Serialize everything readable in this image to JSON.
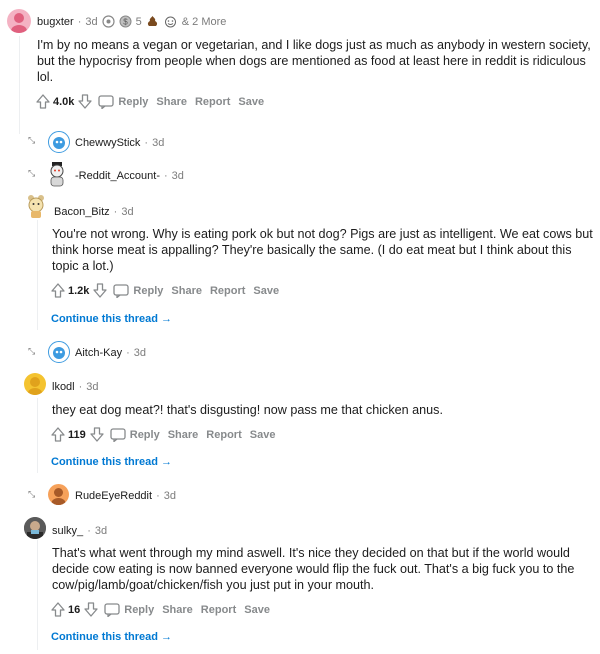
{
  "comments": [
    {
      "username": "bugxter",
      "age": "3d",
      "award_count": "5",
      "more_awards": "& 2 More",
      "text_lines": [
        "I'm by no means a vegan or vegetarian, and I like dogs just as much as anybody in western society,",
        "but the hypocrisy from people when dogs are mentioned as food at least here in reddit is ridiculous",
        "lol."
      ],
      "score": "4.0k"
    },
    {
      "username": "ChewwyStick",
      "age": "3d"
    },
    {
      "username": "-Reddit_Account-",
      "age": "3d"
    },
    {
      "username": "Bacon_Bitz",
      "age": "3d",
      "text_lines": [
        "You're not wrong. Why is eating pork ok but not dog? Pigs are just as intelligent. We eat cows but",
        "think horse meat is appalling? They're basically the same. (I do eat meat but I think about this",
        "topic a lot.)"
      ],
      "score": "1.2k"
    },
    {
      "username": "Aitch-Kay",
      "age": "3d"
    },
    {
      "username": "lkodl",
      "age": "3d",
      "text_lines": [
        "they eat dog meat?! that's disgusting! now pass me that chicken anus."
      ],
      "score": "119"
    },
    {
      "username": "RudeEyeReddit",
      "age": "3d"
    },
    {
      "username": "sulky_",
      "age": "3d",
      "text_lines": [
        "That's what went through my mind aswell. It's nice they decided on that but if the world would",
        "decide cow eating is now banned everyone would flip the fuck out. That's a big fuck you to the",
        "cow/pig/lamb/goat/chicken/fish you just put in your mouth."
      ],
      "score": "16"
    }
  ],
  "actions": {
    "reply": "Reply",
    "share": "Share",
    "report": "Report",
    "save": "Save"
  },
  "continue_label": "Continue this thread",
  "separator": "·",
  "colors": {
    "link": "#0079d3",
    "meta": "#7c7c7c",
    "action": "#878a8c"
  }
}
